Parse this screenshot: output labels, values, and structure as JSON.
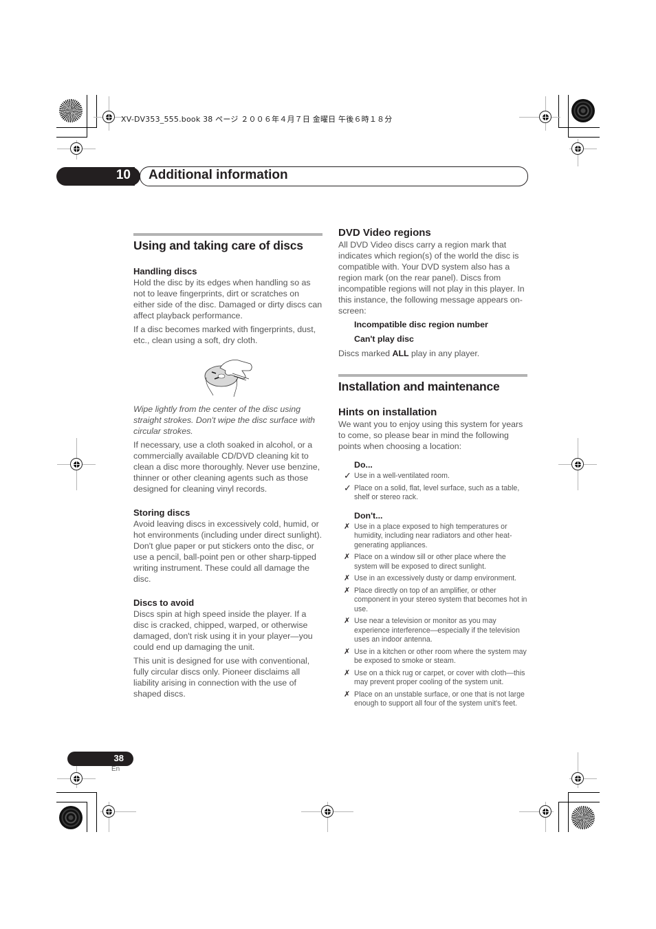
{
  "file_header": "XV-DV353_555.book  38 ページ  ２００６年４月７日  金曜日  午後６時１８分",
  "chapter": {
    "number": "10",
    "title": "Additional information"
  },
  "left_column": {
    "section_title": "Using and taking care of discs",
    "handling": {
      "title": "Handling discs",
      "paragraphs": [
        "Hold the disc by its edges when handling so as not to leave fingerprints, dirt or scratches on either side of the disc. Damaged or dirty discs can affect playback performance.",
        "If a disc becomes marked with fingerprints, dust, etc., clean using a soft, dry cloth."
      ],
      "illustration": "disc-cleaning-illustration",
      "caption": "Wipe lightly from the center of the disc using straight strokes. Don't wipe the disc surface with circular strokes.",
      "after_caption": "If necessary, use a cloth soaked in alcohol, or a commercially available CD/DVD cleaning kit to clean a disc more thoroughly. Never use benzine, thinner or other cleaning agents such as those designed for cleaning vinyl records."
    },
    "storing": {
      "title": "Storing discs",
      "paragraph": "Avoid leaving discs in excessively cold, humid, or hot environments (including under direct sunlight). Don't glue paper or put stickers onto the disc, or use a pencil, ball-point pen or other sharp-tipped writing instrument. These could all damage the disc."
    },
    "avoid": {
      "title": "Discs to avoid",
      "paragraphs": [
        "Discs spin at high speed inside the player. If a disc is cracked, chipped, warped, or otherwise damaged, don't risk using it in your player—you could end up damaging the unit.",
        "This unit is designed for use with conventional, fully circular discs only. Pioneer disclaims all liability arising in connection with the use of shaped discs."
      ]
    }
  },
  "right_column": {
    "dvd_regions": {
      "title": "DVD Video regions",
      "paragraph": "All DVD Video discs carry a region mark that indicates which region(s) of the world the disc is compatible with. Your DVD system also has a region mark (on the rear panel). Discs from incompatible regions will not play in this player. In this instance, the following message appears on-screen:",
      "messages": [
        "Incompatible disc region number",
        "Can't play disc"
      ],
      "all_note_prefix": "Discs marked ",
      "all_note_bold": "ALL",
      "all_note_suffix": " play in any player."
    },
    "section_title": "Installation and maintenance",
    "hints": {
      "title": "Hints on installation",
      "paragraph": "We want you to enjoy using this system for years to come, so please bear in mind the following points when choosing a location:",
      "do_heading": "Do...",
      "do_mark": "✓",
      "do_items": [
        "Use in a well-ventilated room.",
        "Place on a solid, flat, level surface, such as a table, shelf or stereo rack."
      ],
      "dont_heading": "Don't...",
      "dont_mark": "✗",
      "dont_items": [
        "Use in a place exposed to high temperatures or humidity, including near radiators and other heat-generating appliances.",
        "Place on a window sill or other place where the system will be exposed to direct sunlight.",
        "Use in an excessively dusty or damp environment.",
        "Place directly on top of an amplifier, or other component in your stereo system that becomes hot in use.",
        "Use near a television or monitor as you may experience interference—especially if the television uses an indoor antenna.",
        "Use in a kitchen or other room where the system may be exposed to smoke or steam.",
        "Use on a thick rug or carpet, or cover with cloth—this may prevent proper cooling of the system unit.",
        "Place on an unstable surface, or one that is not large enough to support all four of the system unit's feet."
      ]
    }
  },
  "footer": {
    "page_number": "38",
    "language": "En"
  }
}
